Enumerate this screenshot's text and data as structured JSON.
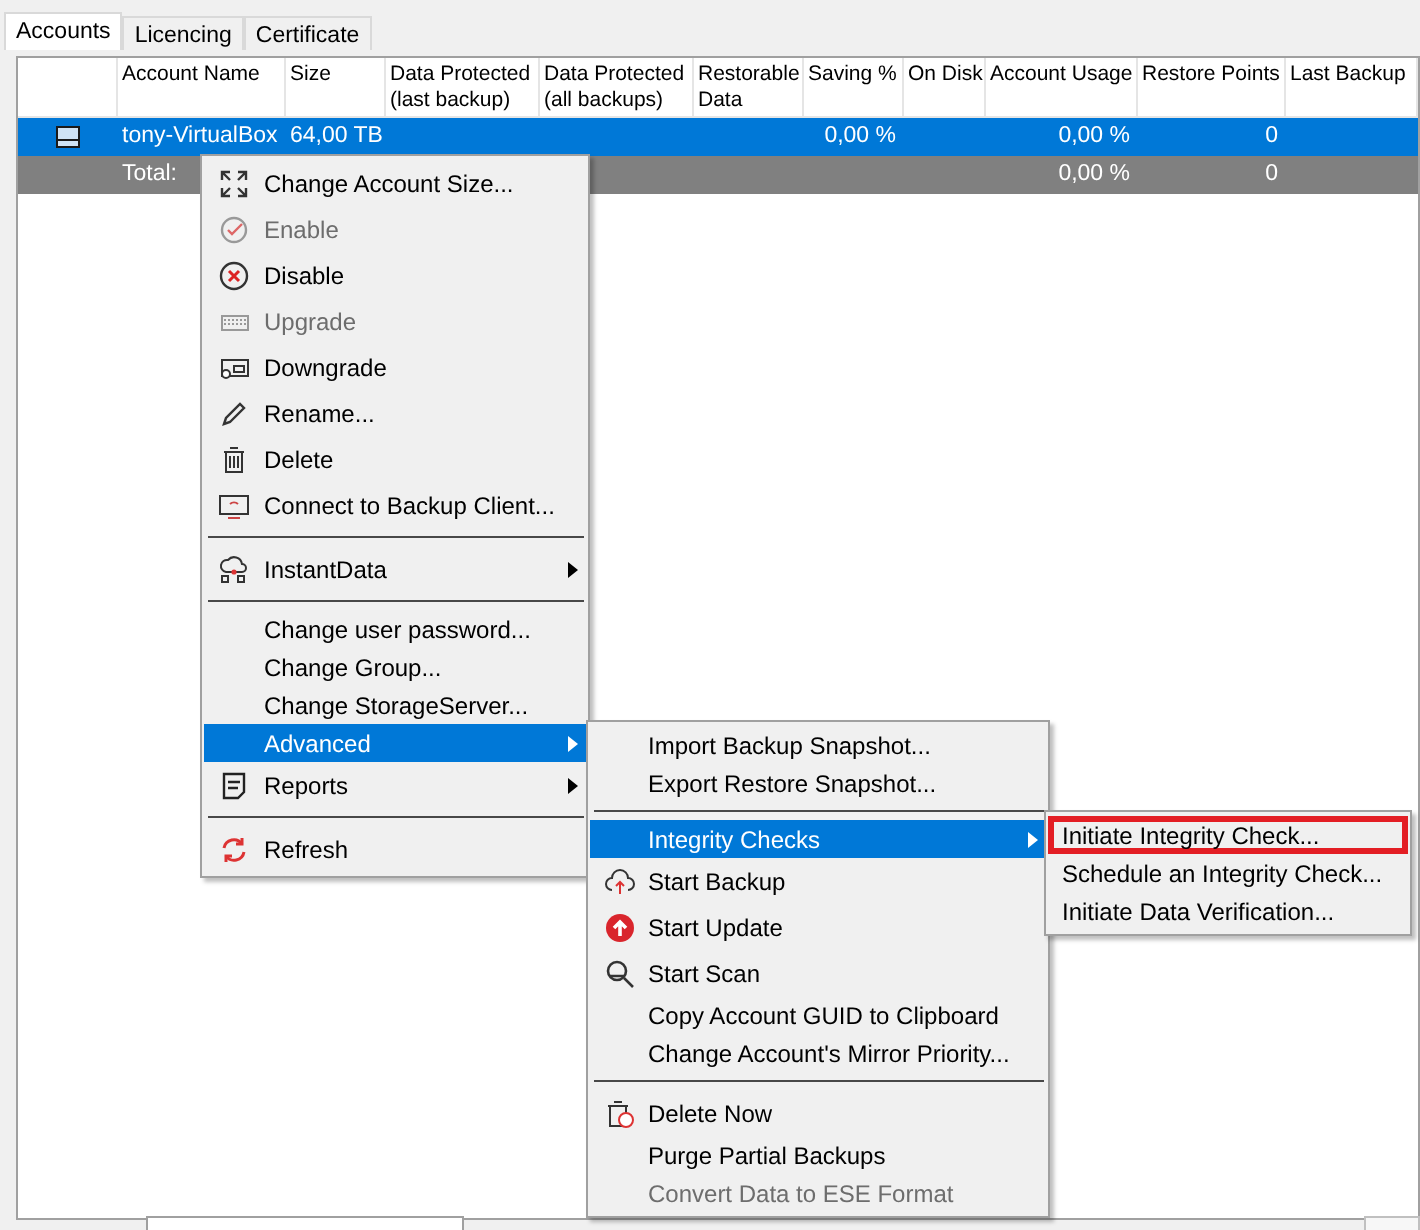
{
  "tabs": [
    {
      "label": "Accounts",
      "selected": true
    },
    {
      "label": "Licencing",
      "selected": false
    },
    {
      "label": "Certificate",
      "selected": false
    }
  ],
  "table": {
    "columns": [
      "Account Name",
      "Size",
      "Data Protected (last backup)",
      "Data Protected (all backups)",
      "Restorable Data",
      "Saving %",
      "On Disk",
      "Account Usage",
      "Restore Points",
      "Last Backup"
    ],
    "rows": [
      {
        "kind": "account",
        "selected": true,
        "cells": [
          "tony-VirtualBox",
          "64,00 TB",
          "",
          "",
          "",
          "0,00 %",
          "",
          "0,00 %",
          "0",
          ""
        ]
      },
      {
        "kind": "total",
        "selected": false,
        "cells": [
          "Total:",
          "",
          "",
          "",
          "",
          "",
          "",
          "0,00 %",
          "0",
          ""
        ]
      }
    ]
  },
  "menus": [
    {
      "items": [
        {
          "kind": "item",
          "label": "Change Account Size...",
          "disabled": false,
          "selected": false,
          "submenu": false
        },
        {
          "kind": "item",
          "label": "Enable",
          "disabled": true,
          "selected": false,
          "submenu": false
        },
        {
          "kind": "item",
          "label": "Disable",
          "disabled": false,
          "selected": false,
          "submenu": false
        },
        {
          "kind": "item",
          "label": "Upgrade",
          "disabled": true,
          "selected": false,
          "submenu": false
        },
        {
          "kind": "item",
          "label": "Downgrade",
          "disabled": false,
          "selected": false,
          "submenu": false
        },
        {
          "kind": "item",
          "label": "Rename...",
          "disabled": false,
          "selected": false,
          "submenu": false
        },
        {
          "kind": "item",
          "label": "Delete",
          "disabled": false,
          "selected": false,
          "submenu": false
        },
        {
          "kind": "item",
          "label": "Connect to Backup Client...",
          "disabled": false,
          "selected": false,
          "submenu": false
        },
        {
          "kind": "separator"
        },
        {
          "kind": "item",
          "label": "InstantData",
          "disabled": false,
          "selected": false,
          "submenu": true
        },
        {
          "kind": "separator"
        },
        {
          "kind": "item",
          "label": "Change user password...",
          "disabled": false,
          "selected": false,
          "submenu": false
        },
        {
          "kind": "item",
          "label": "Change Group...",
          "disabled": false,
          "selected": false,
          "submenu": false
        },
        {
          "kind": "item",
          "label": "Change StorageServer...",
          "disabled": false,
          "selected": false,
          "submenu": false
        },
        {
          "kind": "item",
          "label": "Advanced",
          "disabled": false,
          "selected": true,
          "submenu": true
        },
        {
          "kind": "item",
          "label": "Reports",
          "disabled": false,
          "selected": false,
          "submenu": true
        },
        {
          "kind": "separator"
        },
        {
          "kind": "item",
          "label": "Refresh",
          "disabled": false,
          "selected": false,
          "submenu": false
        }
      ]
    },
    {
      "items": [
        {
          "kind": "item",
          "label": "Import Backup Snapshot...",
          "disabled": false,
          "selected": false,
          "submenu": false
        },
        {
          "kind": "item",
          "label": "Export Restore Snapshot...",
          "disabled": false,
          "selected": false,
          "submenu": false
        },
        {
          "kind": "separator"
        },
        {
          "kind": "item",
          "label": "Integrity Checks",
          "disabled": false,
          "selected": true,
          "submenu": true
        },
        {
          "kind": "item",
          "label": "Start Backup",
          "disabled": false,
          "selected": false,
          "submenu": false
        },
        {
          "kind": "item",
          "label": "Start Update",
          "disabled": false,
          "selected": false,
          "submenu": false
        },
        {
          "kind": "item",
          "label": "Start Scan",
          "disabled": false,
          "selected": false,
          "submenu": false
        },
        {
          "kind": "item",
          "label": "Copy Account GUID to Clipboard",
          "disabled": false,
          "selected": false,
          "submenu": false
        },
        {
          "kind": "item",
          "label": "Change Account's Mirror Priority...",
          "disabled": false,
          "selected": false,
          "submenu": false
        },
        {
          "kind": "separator"
        },
        {
          "kind": "item",
          "label": "Delete Now",
          "disabled": false,
          "selected": false,
          "submenu": false
        },
        {
          "kind": "item",
          "label": "Purge Partial Backups",
          "disabled": false,
          "selected": false,
          "submenu": false
        },
        {
          "kind": "item",
          "label": "Convert Data to ESE Format",
          "disabled": true,
          "selected": false,
          "submenu": false
        }
      ]
    },
    {
      "items": [
        {
          "kind": "item",
          "label": "Initiate Integrity Check...",
          "disabled": false,
          "selected": false,
          "submenu": false,
          "annotated": true
        },
        {
          "kind": "item",
          "label": "Schedule an Integrity Check...",
          "disabled": false,
          "selected": false,
          "submenu": false,
          "annotated": false
        },
        {
          "kind": "item",
          "label": "Initiate Data Verification...",
          "disabled": false,
          "selected": false,
          "submenu": false,
          "annotated": false
        }
      ]
    }
  ]
}
